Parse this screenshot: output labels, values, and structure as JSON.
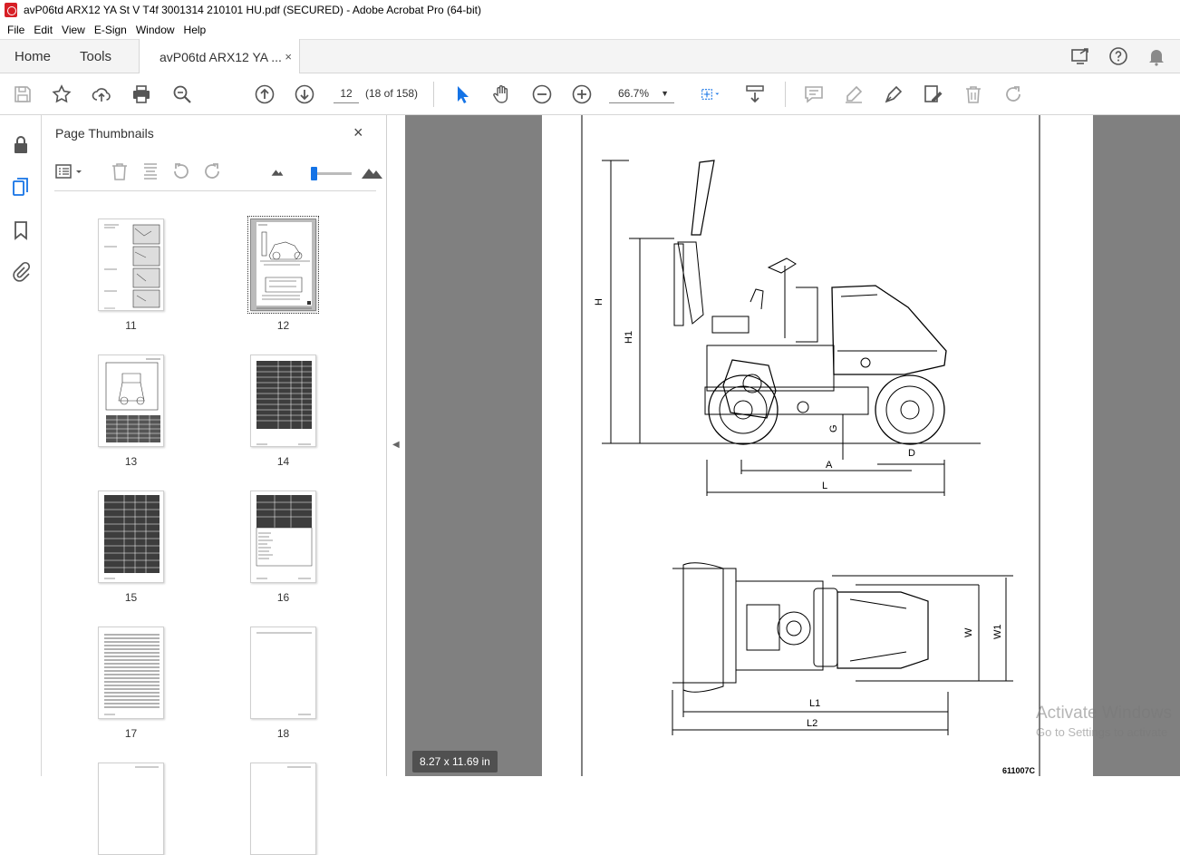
{
  "window": {
    "title": "avP06td ARX12 YA St V T4f 3001314 210101 HU.pdf (SECURED) - Adobe Acrobat Pro (64-bit)"
  },
  "menu": [
    "File",
    "Edit",
    "View",
    "E-Sign",
    "Window",
    "Help"
  ],
  "tabs": {
    "home": "Home",
    "tools": "Tools",
    "document": "avP06td ARX12 YA ...",
    "close": "×"
  },
  "toolbar": {
    "page_number": "12",
    "page_count": "(18 of 158)",
    "zoom": "66.7%"
  },
  "thumbnails_panel": {
    "title": "Page Thumbnails",
    "close": "×",
    "pages": [
      {
        "label": "11",
        "selected": false
      },
      {
        "label": "12",
        "selected": true
      },
      {
        "label": "13",
        "selected": false
      },
      {
        "label": "14",
        "selected": false
      },
      {
        "label": "15",
        "selected": false
      },
      {
        "label": "16",
        "selected": false
      },
      {
        "label": "17",
        "selected": false
      },
      {
        "label": "18",
        "selected": false
      }
    ]
  },
  "document": {
    "page_size": "8.27 x 11.69 in",
    "drawing_labels": {
      "h": "H",
      "h1": "H1",
      "g": "G",
      "a": "A",
      "d": "D",
      "l": "L",
      "w": "W",
      "w1": "W1",
      "l1": "L1",
      "l2": "L2",
      "ref": "611007C"
    }
  },
  "watermark": {
    "line1": "Activate Windows",
    "line2": "Go to Settings to activate"
  }
}
